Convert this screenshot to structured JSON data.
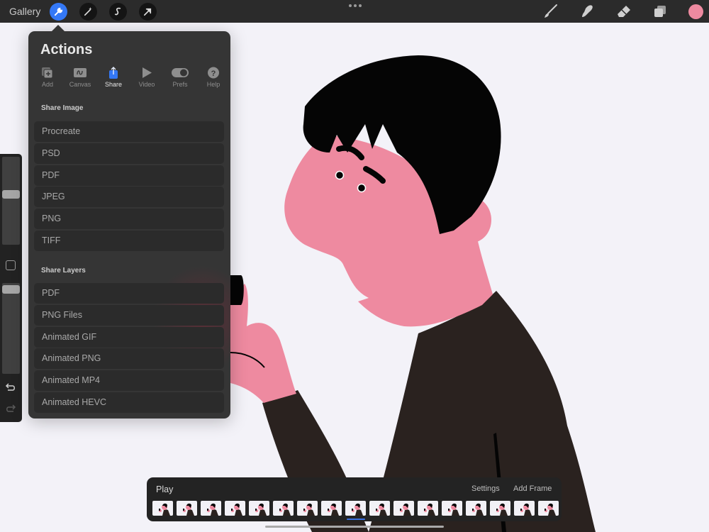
{
  "topbar": {
    "gallery_label": "Gallery",
    "left_tools": [
      {
        "name": "actions",
        "icon": "wrench-icon",
        "active": true
      },
      {
        "name": "adjustments",
        "icon": "magic-wand-icon",
        "active": false
      },
      {
        "name": "selection",
        "icon": "selection-s-icon",
        "active": false
      },
      {
        "name": "transform",
        "icon": "arrow-cursor-icon",
        "active": false
      }
    ],
    "more_icon": "ellipsis-icon",
    "right_tools": [
      {
        "name": "brush",
        "icon": "brush-icon"
      },
      {
        "name": "smudge",
        "icon": "smudge-icon"
      },
      {
        "name": "eraser",
        "icon": "eraser-icon"
      },
      {
        "name": "layers",
        "icon": "layers-icon"
      }
    ],
    "current_color": "#ee8aa0"
  },
  "actions_popover": {
    "title": "Actions",
    "tabs": [
      {
        "label": "Add",
        "icon": "add-icon",
        "active": false
      },
      {
        "label": "Canvas",
        "icon": "canvas-icon",
        "active": false
      },
      {
        "label": "Share",
        "icon": "share-icon",
        "active": true
      },
      {
        "label": "Video",
        "icon": "play-icon",
        "active": false
      },
      {
        "label": "Prefs",
        "icon": "toggle-icon",
        "active": false
      },
      {
        "label": "Help",
        "icon": "help-icon",
        "active": false
      }
    ],
    "share_image": {
      "label": "Share Image",
      "items": [
        "Procreate",
        "PSD",
        "PDF",
        "JPEG",
        "PNG",
        "TIFF"
      ]
    },
    "share_layers": {
      "label": "Share Layers",
      "items": [
        "PDF",
        "PNG Files",
        "Animated GIF",
        "Animated PNG",
        "Animated MP4",
        "Animated HEVC"
      ]
    }
  },
  "sidebar": {
    "brush_size_fraction": 0.58,
    "opacity_fraction": 0.97
  },
  "timeline": {
    "play_label": "Play",
    "settings_label": "Settings",
    "add_frame_label": "Add Frame",
    "frame_count": 17,
    "current_frame_index": 8
  },
  "colors": {
    "accent": "#3478f6",
    "skin": "#ee8aa0",
    "hair": "#050505",
    "sweater": "#2a221f",
    "canvas_bg": "#f3f2f8"
  }
}
